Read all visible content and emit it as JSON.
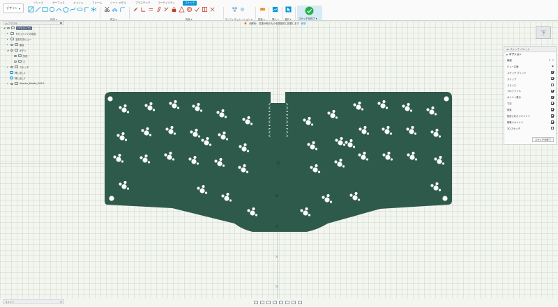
{
  "ribbon": {
    "design_label": "デザイン",
    "tabs": [
      "ソリッド",
      "サーフェス",
      "メッシュ",
      "フォーム",
      "シート メタル",
      "プラスチック",
      "ユーティリティ",
      "スケッチ"
    ],
    "groups": [
      "作成",
      "修正",
      "拘束",
      "コンフィギュレーション",
      "検査",
      "挿入",
      "選択",
      "スケッチを終了"
    ],
    "finish_sketch_label": "スケッチを終了"
  },
  "notice": {
    "label": "未解析:",
    "text": "変更が他のものを間接的に影響します",
    "link": "解析"
  },
  "browser": {
    "title": "ブラウザ",
    "items": [
      {
        "label": "(アクティブ)",
        "level": 0
      },
      {
        "label": "ドキュメントの設定",
        "level": 1
      },
      {
        "label": "名前付きビュー",
        "level": 1
      },
      {
        "label": "原点",
        "level": 1
      },
      {
        "label": "ボディ",
        "level": 1
      },
      {
        "label": "外形",
        "level": 2
      },
      {
        "label": "穴",
        "level": 2
      },
      {
        "label": "スケッチ",
        "level": 1
      },
      {
        "label": "押し出し1",
        "level": 1
      },
      {
        "label": "押し出し2",
        "level": 1
      },
      {
        "label": "Akasha_Middle_PCB:1",
        "level": 1
      }
    ]
  },
  "viewcube": {
    "face": "下"
  },
  "palette": {
    "title": "スケッチ パレット",
    "options_title": "オプション",
    "options": [
      {
        "label": "線種",
        "checked": null
      },
      {
        "label": "ビュー正面",
        "checked": null
      },
      {
        "label": "スケッチ グリッド",
        "checked": true
      },
      {
        "label": "スナップ",
        "checked": true
      },
      {
        "label": "スライス",
        "checked": false
      },
      {
        "label": "プロファイル",
        "checked": true
      },
      {
        "label": "ポイント表示",
        "checked": true
      },
      {
        "label": "寸法",
        "checked": true
      },
      {
        "label": "拘束",
        "checked": true
      },
      {
        "label": "投影されたジオメトリ",
        "checked": true
      },
      {
        "label": "構築ジオメトリ",
        "checked": true
      },
      {
        "label": "3D スケッチ",
        "checked": false
      }
    ],
    "finish_label": "スケッチを終了"
  },
  "bottom": {
    "comments": "コメント"
  },
  "colors": {
    "pcb": "#2e5a4c",
    "accent": "#0696d7",
    "finish": "#25b04a"
  }
}
